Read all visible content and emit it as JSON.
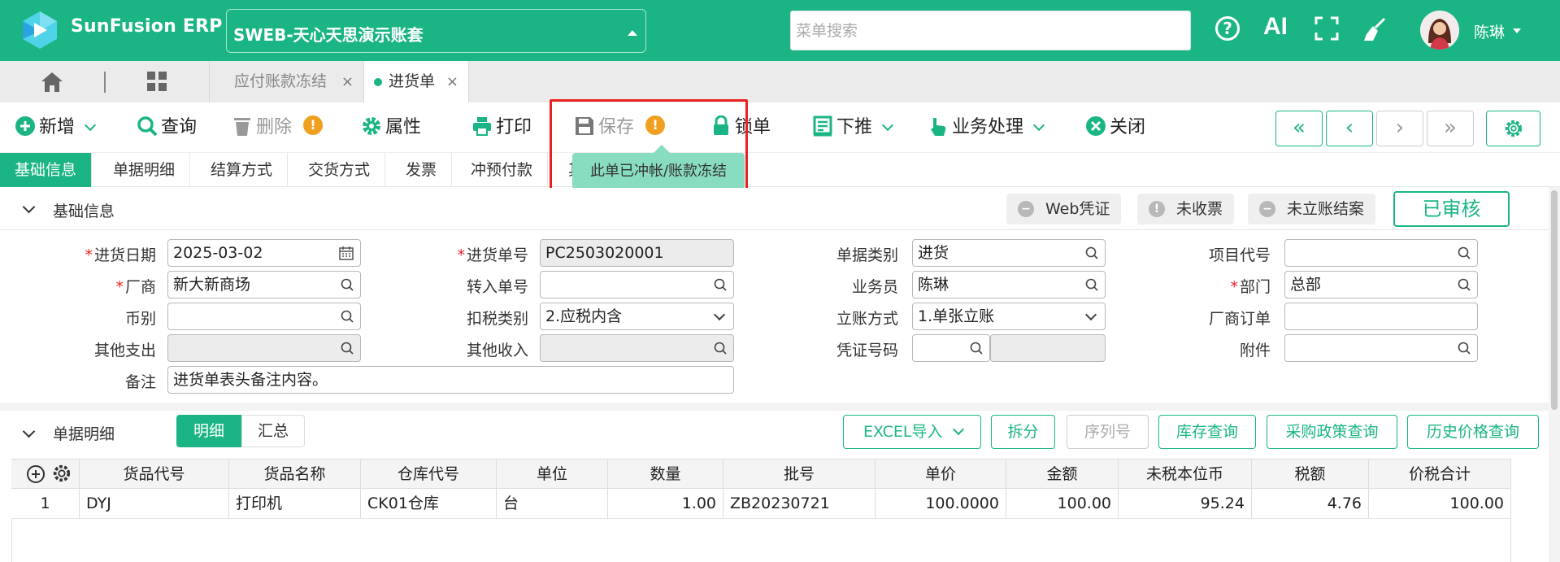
{
  "header": {
    "brand": "SunFusion ERP",
    "account": "SWEB-天心天思演示账套",
    "search_placeholder": "菜单搜索",
    "ai_label": "AI",
    "user_name": "陈琳"
  },
  "tabs": {
    "tab1": "应付账款冻结",
    "tab2": "进货单",
    "close": "×"
  },
  "toolbar": {
    "new": "新增",
    "query": "查询",
    "delete": "删除",
    "properties": "属性",
    "print": "打印",
    "save": "保存",
    "lock": "锁单",
    "push_down": "下推",
    "business": "业务处理",
    "close": "关闭",
    "warn": "!",
    "tooltip": "此单已冲帐/账款冻结",
    "nav_first": "«",
    "nav_prev": "‹",
    "nav_next": "›",
    "nav_last": "»"
  },
  "section_tabs": [
    "基础信息",
    "单据明细",
    "结算方式",
    "交货方式",
    "发票",
    "冲预付款",
    "其"
  ],
  "basic": {
    "title": "基础信息",
    "web_voucher": "Web凭证",
    "not_invoiced": "未收票",
    "not_settled": "未立账结案",
    "status": "已审核"
  },
  "form": {
    "date_label": "进货日期",
    "date_value": "2025-03-02",
    "no_label": "进货单号",
    "no_value": "PC2503020001",
    "type_label": "单据类别",
    "type_value": "进货",
    "project_label": "项目代号",
    "project_value": "",
    "vendor_label": "厂商",
    "vendor_value": "新大新商场",
    "transfer_label": "转入单号",
    "transfer_value": "",
    "staff_label": "业务员",
    "staff_value": "陈琳",
    "dept_label": "部门",
    "dept_value": "总部",
    "currency_label": "币别",
    "currency_value": "",
    "tax_label": "扣税类别",
    "tax_value": "2.应税内含",
    "account_label": "立账方式",
    "account_value": "1.单张立账",
    "vendor_order_label": "厂商订单",
    "vendor_order_value": "",
    "other_exp_label": "其他支出",
    "other_exp_value": "",
    "other_inc_label": "其他收入",
    "other_inc_value": "",
    "voucher_label": "凭证号码",
    "voucher_value": "",
    "attach_label": "附件",
    "attach_value": "",
    "remark_label": "备注",
    "remark_value": "进货单表头备注内容。",
    "required_mark": "*"
  },
  "detail": {
    "title": "单据明细",
    "seg_detail": "明细",
    "seg_summary": "汇总",
    "excel": "EXCEL导入",
    "split": "拆分",
    "serial": "序列号",
    "stock_query": "库存查询",
    "policy_query": "采购政策查询",
    "history_query": "历史价格查询"
  },
  "table": {
    "columns": [
      "货品代号",
      "货品名称",
      "仓库代号",
      "单位",
      "数量",
      "批号",
      "单价",
      "金额",
      "未税本位币",
      "税额",
      "价税合计"
    ],
    "rows": [
      {
        "idx": "1",
        "code": "DYJ",
        "name": "打印机",
        "wh": "CK01仓库",
        "unit": "台",
        "qty": "1.00",
        "batch": "ZB20230721",
        "price": "100.0000",
        "amount": "100.00",
        "untaxed": "95.24",
        "tax": "4.76",
        "total": "100.00"
      }
    ]
  },
  "colors": {
    "brand": "#1bb585",
    "warn": "#f0a020",
    "highlight": "#e8231f"
  }
}
